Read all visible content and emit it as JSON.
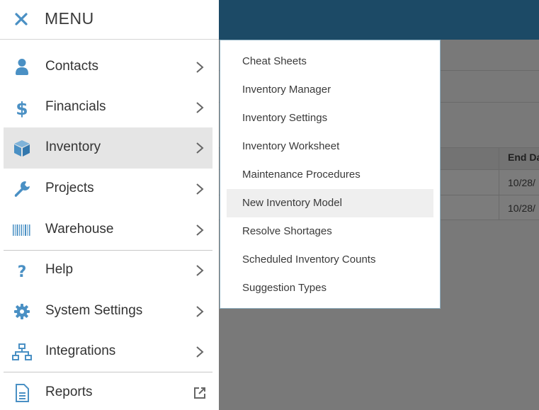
{
  "menu": {
    "title": "MENU",
    "items": [
      {
        "label": "Contacts",
        "icon": "person-icon"
      },
      {
        "label": "Financials",
        "icon": "dollar-icon"
      },
      {
        "label": "Inventory",
        "icon": "box-icon"
      },
      {
        "label": "Projects",
        "icon": "wrench-icon"
      },
      {
        "label": "Warehouse",
        "icon": "barcode-icon"
      },
      {
        "label": "Help",
        "icon": "question-icon"
      },
      {
        "label": "System Settings",
        "icon": "gear-icon"
      },
      {
        "label": "Integrations",
        "icon": "network-icon"
      },
      {
        "label": "Reports",
        "icon": "document-icon"
      }
    ]
  },
  "submenu": {
    "items": [
      "Cheat Sheets",
      "Inventory Manager",
      "Inventory Settings",
      "Inventory Worksheet",
      "Maintenance Procedures",
      "New Inventory Model",
      "Resolve Shortages",
      "Scheduled Inventory Counts",
      "Suggestion Types"
    ]
  },
  "background": {
    "table_header": "End Da",
    "cells": [
      "10/28/",
      "10/28/"
    ]
  },
  "colors": {
    "accent": "#4a90c4",
    "header_bar": "#1c4a66",
    "active_item": "#e5e5e5"
  }
}
